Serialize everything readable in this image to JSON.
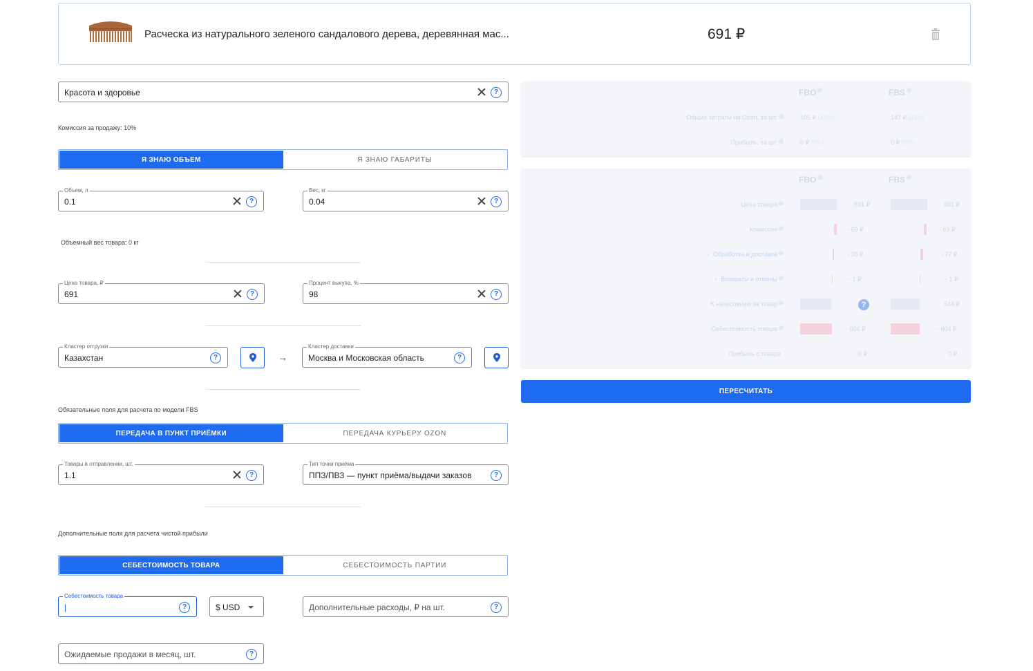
{
  "product": {
    "title": "Расческа из натурального зеленого сандалового дерева, деревянная мас...",
    "price": "691 ₽",
    "image_icon": "comb-image",
    "delete_icon": "trash-icon"
  },
  "category": {
    "value": "Красота и здоровье"
  },
  "commission_note": "Комиссия за продажу: 10%",
  "size_toggle": {
    "option1": "Я ЗНАЮ ОБЪЕМ",
    "option2": "Я ЗНАЮ ГАБАРИТЫ",
    "selected": 1
  },
  "volume": {
    "label": "Объем, л",
    "value": "0.1"
  },
  "weight": {
    "label": "Вес, кг",
    "value": "0.04"
  },
  "volume_weight_note": "Объемный вес товара: 0 кг",
  "price_field": {
    "label": "Цена товара, ₽",
    "value": "691"
  },
  "buyout_field": {
    "label": "Процент выкупа, %",
    "value": "98"
  },
  "ship_cluster": {
    "label": "Кластер отгрузки",
    "value": "Казахстан"
  },
  "arrow": "→",
  "delivery_cluster": {
    "label": "Кластер доставки",
    "value": "Москва и Московская область"
  },
  "fbs_note": "Обязательные поля для расчета по модели FBS",
  "transfer_toggle": {
    "option1": "ПЕРЕДАЧА В ПУНКТ ПРИЁМКИ",
    "option2": "ПЕРЕДАЧА КУРЬЕРУ OZON",
    "selected": 1
  },
  "items_in_shipment": {
    "label": "Товары в отправлении, шт.",
    "value": "1.1"
  },
  "point_type": {
    "label": "Тип точки приёма",
    "value": "ППЗ/ПВЗ — пункт приёма/выдачи заказов"
  },
  "extra_note": "Дополнительные поля для расчета чистой прибыли",
  "cost_toggle": {
    "option1": "СЕБЕСТОИМОСТЬ ТОВАРА",
    "option2": "СЕБЕСТОИМОСТЬ ПАРТИИ",
    "selected": 1
  },
  "cost_field": {
    "label": "Себестоимость товара",
    "value": "|"
  },
  "currency": {
    "value": "$ USD"
  },
  "extra_costs": {
    "placeholder": "Дополнительные расходы, ₽ на шт."
  },
  "expected_sales": {
    "placeholder": "Ожидаемые продажи в месяц, шт."
  },
  "summary": {
    "col1": "FBO",
    "col2": "FBS",
    "rows": [
      {
        "label": "Общие затраты на Ozon, за шт.",
        "fbo": "105 ₽",
        "fbo_pct": "(15%)",
        "fbs": "147 ₽",
        "fbs_pct": "(21%)"
      },
      {
        "label": "Прибыль, за шт.",
        "fbo": "0 ₽",
        "fbo_pct": "(0%)",
        "fbs": "0 ₽",
        "fbs_pct": "(0%)"
      }
    ]
  },
  "breakdown": {
    "col1": "FBO",
    "col2": "FBS",
    "rows": [
      {
        "label": "Цена товара",
        "fbo": "691 ₽",
        "fbs": "691 ₽"
      },
      {
        "label": "Комиссия",
        "fbo": "- 69 ₽",
        "fbs": "- 69 ₽"
      },
      {
        "label": "Обработка и доставка",
        "fbo": "- 35 ₽",
        "fbs": "- 77 ₽"
      },
      {
        "label": "Возвраты и отмены",
        "fbo": "- 1 ₽",
        "fbs": "- 1 ₽"
      },
      {
        "label": "К начислению за товар",
        "fbo": "?",
        "fbs": "544 ₽"
      },
      {
        "label": "Себестоимость товара",
        "fbo": "- 604 ₽",
        "fbs": "- 604 ₽"
      },
      {
        "label": "Прибыль с товара",
        "fbo": "0 ₽",
        "fbs": "0 ₽"
      }
    ]
  },
  "recalc_button": "ПЕРЕСЧИТАТЬ",
  "colors": {
    "accent": "#1e6bf0",
    "border": "#8a8a8a"
  }
}
